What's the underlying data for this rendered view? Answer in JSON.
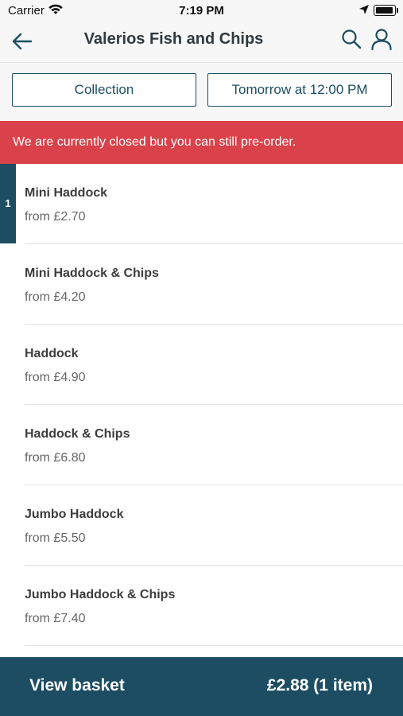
{
  "status_bar": {
    "carrier": "Carrier",
    "time": "7:19 PM",
    "icons": [
      "wifi-icon",
      "location-arrow-icon",
      "battery-icon"
    ]
  },
  "nav": {
    "title": "Valerios Fish and Chips",
    "icons": [
      "back-arrow-icon",
      "search-icon",
      "account-icon"
    ]
  },
  "order_options": {
    "collection_label": "Collection",
    "time_label": "Tomorrow at 12:00 PM"
  },
  "banner": {
    "message": "We are currently closed but you can still pre-order."
  },
  "menu": {
    "items": [
      {
        "name": "Mini Haddock",
        "price": "from £2.70",
        "qty": "1"
      },
      {
        "name": "Mini Haddock & Chips",
        "price": "from £4.20"
      },
      {
        "name": "Haddock",
        "price": "from £4.90"
      },
      {
        "name": "Haddock & Chips",
        "price": "from £6.80"
      },
      {
        "name": "Jumbo Haddock",
        "price": "from £5.50"
      },
      {
        "name": "Jumbo Haddock & Chips",
        "price": "from £7.40"
      }
    ]
  },
  "basket": {
    "label": "View basket",
    "total": "£2.88 (1 item)"
  },
  "colors": {
    "primary": "#1c4d63",
    "banner": "#d9424a"
  }
}
